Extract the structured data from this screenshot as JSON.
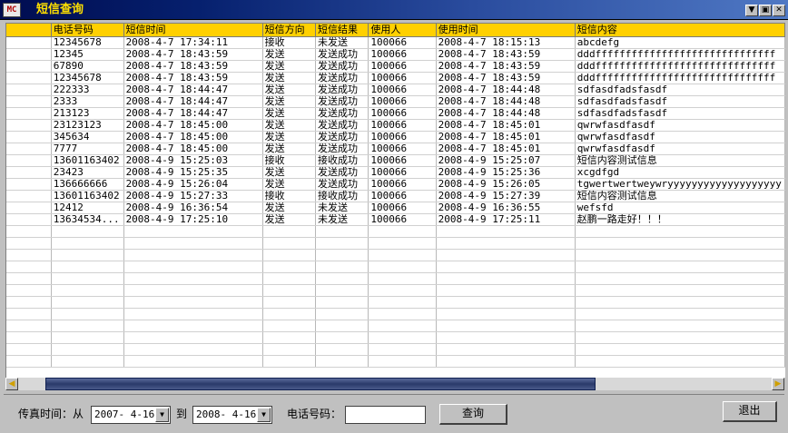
{
  "window": {
    "icon_text": "MC",
    "title": "短信查询",
    "controls": [
      "▼",
      "▣",
      "✕"
    ]
  },
  "grid": {
    "columns": [
      "",
      "电话号码",
      "短信时间",
      "短信方向",
      "短信结果",
      "使用人",
      "使用时间",
      "短信内容"
    ],
    "rows": [
      [
        "",
        "12345678",
        "2008-4-7 17:34:11",
        "接收",
        "未发送",
        "100066",
        "2008-4-7 18:15:13",
        "abcdefg"
      ],
      [
        "",
        "12345",
        "2008-4-7 18:43:59",
        "发送",
        "发送成功",
        "100066",
        "2008-4-7 18:43:59",
        "dddffffffffffffffffffffffffffffff"
      ],
      [
        "",
        "67890",
        "2008-4-7 18:43:59",
        "发送",
        "发送成功",
        "100066",
        "2008-4-7 18:43:59",
        "dddffffffffffffffffffffffffffffff"
      ],
      [
        "",
        "12345678",
        "2008-4-7 18:43:59",
        "发送",
        "发送成功",
        "100066",
        "2008-4-7 18:43:59",
        "dddffffffffffffffffffffffffffffff"
      ],
      [
        "",
        "222333",
        "2008-4-7 18:44:47",
        "发送",
        "发送成功",
        "100066",
        "2008-4-7 18:44:48",
        "sdfasdfadsfasdf"
      ],
      [
        "",
        "2333",
        "2008-4-7 18:44:47",
        "发送",
        "发送成功",
        "100066",
        "2008-4-7 18:44:48",
        "sdfasdfadsfasdf"
      ],
      [
        "",
        "213123",
        "2008-4-7 18:44:47",
        "发送",
        "发送成功",
        "100066",
        "2008-4-7 18:44:48",
        "sdfasdfadsfasdf"
      ],
      [
        "",
        "23123123",
        "2008-4-7 18:45:00",
        "发送",
        "发送成功",
        "100066",
        "2008-4-7 18:45:01",
        "qwrwfasdfasdf"
      ],
      [
        "",
        "345634",
        "2008-4-7 18:45:00",
        "发送",
        "发送成功",
        "100066",
        "2008-4-7 18:45:01",
        "qwrwfasdfasdf"
      ],
      [
        "",
        "7777",
        "2008-4-7 18:45:00",
        "发送",
        "发送成功",
        "100066",
        "2008-4-7 18:45:01",
        "qwrwfasdfasdf"
      ],
      [
        "",
        "13601163402",
        "2008-4-9 15:25:03",
        "接收",
        "接收成功",
        "100066",
        "2008-4-9 15:25:07",
        "短信内容测试信息"
      ],
      [
        "",
        "23423",
        "2008-4-9 15:25:35",
        "发送",
        "发送成功",
        "100066",
        "2008-4-9 15:25:36",
        "xcgdfgd"
      ],
      [
        "",
        "136666666",
        "2008-4-9 15:26:04",
        "发送",
        "发送成功",
        "100066",
        "2008-4-9 15:26:05",
        "tgwertwertweywryyyyyyyyyyyyyyyyyyy"
      ],
      [
        "",
        "13601163402",
        "2008-4-9 15:27:33",
        "接收",
        "接收成功",
        "100066",
        "2008-4-9 15:27:39",
        "短信内容测试信息"
      ],
      [
        "",
        "12412",
        "2008-4-9 16:36:54",
        "发送",
        "未发送",
        "100066",
        "2008-4-9 16:36:55",
        "wefsfd"
      ],
      [
        "",
        "13634534...",
        "2008-4-9 17:25:10",
        "发送",
        "未发送",
        "100066",
        "2008-4-9 17:25:11",
        "赵鹏一路走好！！！"
      ]
    ]
  },
  "scrollbar": {
    "left_arrow": "◀",
    "right_arrow": "▶"
  },
  "filter": {
    "fax_time_label": "传真时间：从",
    "date_from": "2007- 4-16",
    "to_label": "到",
    "date_to": "2008- 4-16",
    "dropdown_glyph": "▼",
    "phone_label": "电话号码：",
    "phone_value": "",
    "query_button": "查询",
    "exit_button": "退出"
  }
}
